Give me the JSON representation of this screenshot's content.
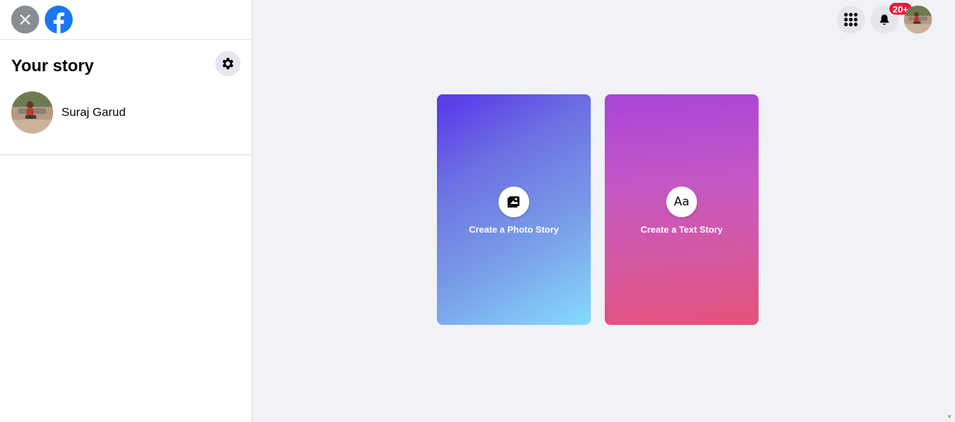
{
  "app": {
    "brand_color": "#1877f2",
    "background": "#f0f2f5"
  },
  "sidebar": {
    "close_icon": "close-icon",
    "logo_icon": "facebook-logo-icon",
    "title": "Your story",
    "settings_icon": "gear-icon",
    "user": {
      "name": "Suraj Garud",
      "avatar": "user-avatar"
    }
  },
  "header": {
    "menu_icon": "grid-menu-icon",
    "notifications_icon": "bell-icon",
    "notifications_badge": "20+",
    "badge_color": "#e41e3f",
    "account_avatar": "account-avatar"
  },
  "cards": [
    {
      "label": "Create a Photo Story",
      "icon": "photo-icon"
    },
    {
      "label": "Create a Text Story",
      "icon": "text-aa-icon",
      "icon_text": "Aa"
    }
  ]
}
